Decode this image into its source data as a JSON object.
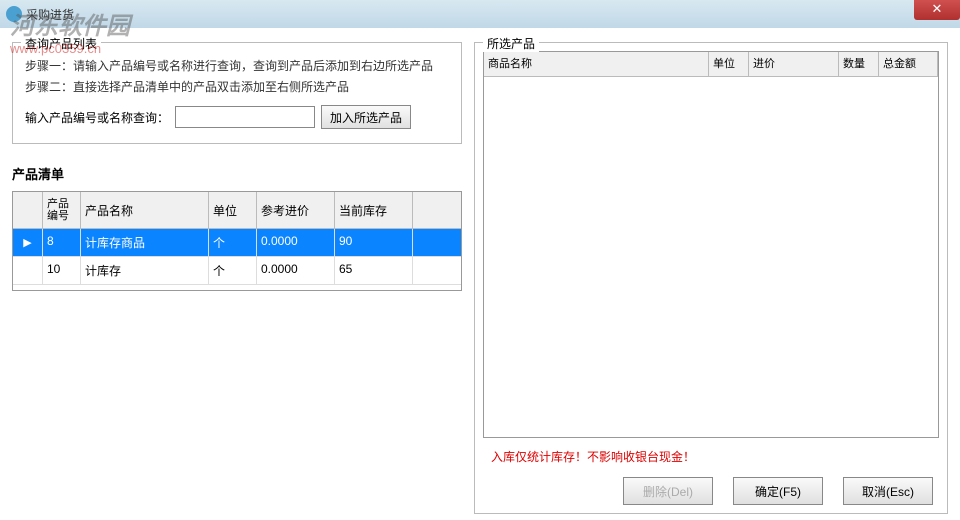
{
  "window": {
    "title": "采购进货"
  },
  "watermark": {
    "text": "河东软件园",
    "url": "www.pc0359.cn"
  },
  "query_panel": {
    "legend": "查询产品列表",
    "step1": "步骤一：请输入产品编号或名称进行查询，查询到产品后添加到右边所选产品",
    "step2": "步骤二：直接选择产品清单中的产品双击添加至右侧所选产品",
    "input_label": "输入产品编号或名称查询：",
    "search_value": "",
    "add_button": "加入所选产品"
  },
  "product_list": {
    "title": "产品清单",
    "headers": {
      "id": "产品编号",
      "name": "产品名称",
      "unit": "单位",
      "ref_price": "参考进价",
      "stock": "当前库存"
    },
    "rows": [
      {
        "id": "8",
        "name": "计库存商品",
        "unit": "个",
        "ref_price": "0.0000",
        "stock": "90",
        "selected": true
      },
      {
        "id": "10",
        "name": "计库存",
        "unit": "个",
        "ref_price": "0.0000",
        "stock": "65",
        "selected": false
      }
    ]
  },
  "selected_panel": {
    "legend": "所选产品",
    "headers": {
      "name": "商品名称",
      "unit": "单位",
      "in_price": "进价",
      "qty": "数量",
      "total": "总金额"
    }
  },
  "warning": "入库仅统计库存！不影响收银台现金！",
  "buttons": {
    "delete": "删除(Del)",
    "confirm": "确定(F5)",
    "cancel": "取消(Esc)"
  }
}
